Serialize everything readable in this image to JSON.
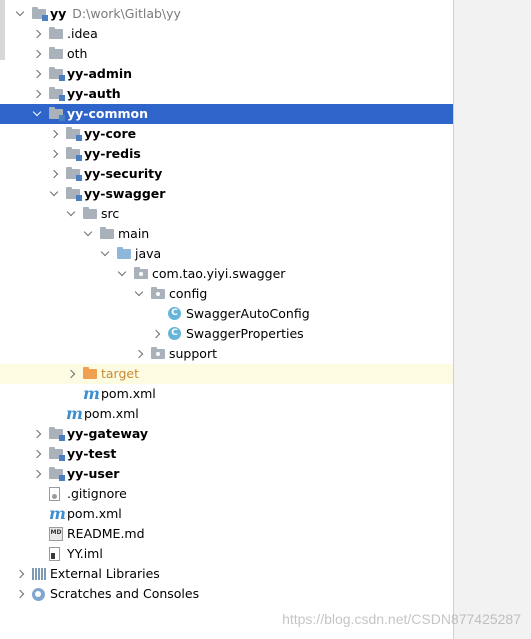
{
  "project": {
    "name": "yy",
    "path": "D:\\work\\Gitlab\\yy"
  },
  "tree": [
    {
      "name": "yy",
      "suffix": "D:\\work\\Gitlab\\yy",
      "bold": true,
      "depth": 0,
      "arrow": "down",
      "icon": "module-folder-icon",
      "kind": "module"
    },
    {
      "name": ".idea",
      "depth": 1,
      "arrow": "right",
      "icon": "folder-icon",
      "kind": "folder"
    },
    {
      "name": "oth",
      "depth": 1,
      "arrow": "right",
      "icon": "folder-icon",
      "kind": "folder"
    },
    {
      "name": "yy-admin",
      "bold": true,
      "depth": 1,
      "arrow": "right",
      "icon": "module-folder-icon",
      "kind": "module"
    },
    {
      "name": "yy-auth",
      "bold": true,
      "depth": 1,
      "arrow": "right",
      "icon": "module-folder-icon",
      "kind": "module"
    },
    {
      "name": "yy-common",
      "bold": true,
      "depth": 1,
      "arrow": "down",
      "icon": "module-folder-icon",
      "kind": "module",
      "selected": true
    },
    {
      "name": "yy-core",
      "bold": true,
      "depth": 2,
      "arrow": "right",
      "icon": "module-folder-icon",
      "kind": "module"
    },
    {
      "name": "yy-redis",
      "bold": true,
      "depth": 2,
      "arrow": "right",
      "icon": "module-folder-icon",
      "kind": "module"
    },
    {
      "name": "yy-security",
      "bold": true,
      "depth": 2,
      "arrow": "right",
      "icon": "module-folder-icon",
      "kind": "module"
    },
    {
      "name": "yy-swagger",
      "bold": true,
      "depth": 2,
      "arrow": "down",
      "icon": "module-folder-icon",
      "kind": "module"
    },
    {
      "name": "src",
      "depth": 3,
      "arrow": "down",
      "icon": "folder-icon",
      "kind": "folder"
    },
    {
      "name": "main",
      "depth": 4,
      "arrow": "down",
      "icon": "folder-icon",
      "kind": "folder"
    },
    {
      "name": "java",
      "depth": 5,
      "arrow": "down",
      "icon": "source-folder-icon",
      "kind": "source"
    },
    {
      "name": "com.tao.yiyi.swagger",
      "depth": 6,
      "arrow": "down",
      "icon": "package-icon",
      "kind": "package"
    },
    {
      "name": "config",
      "depth": 7,
      "arrow": "down",
      "icon": "package-icon",
      "kind": "package"
    },
    {
      "name": "SwaggerAutoConfig",
      "depth": 8,
      "arrow": "none",
      "icon": "class-icon",
      "kind": "class"
    },
    {
      "name": "SwaggerProperties",
      "depth": 8,
      "arrow": "right",
      "icon": "class-icon",
      "kind": "class"
    },
    {
      "name": "support",
      "depth": 7,
      "arrow": "right",
      "icon": "package-icon",
      "kind": "package"
    },
    {
      "name": "target",
      "depth": 3,
      "arrow": "right",
      "icon": "excluded-folder-icon",
      "kind": "excluded",
      "highlight": true
    },
    {
      "name": "pom.xml",
      "depth": 3,
      "arrow": "none",
      "icon": "maven-icon",
      "kind": "maven"
    },
    {
      "name": "pom.xml",
      "depth": 2,
      "arrow": "none",
      "icon": "maven-icon",
      "kind": "maven"
    },
    {
      "name": "yy-gateway",
      "bold": true,
      "depth": 1,
      "arrow": "right",
      "icon": "module-folder-icon",
      "kind": "module"
    },
    {
      "name": "yy-test",
      "bold": true,
      "depth": 1,
      "arrow": "right",
      "icon": "module-folder-icon",
      "kind": "module"
    },
    {
      "name": "yy-user",
      "bold": true,
      "depth": 1,
      "arrow": "right",
      "icon": "module-folder-icon",
      "kind": "module"
    },
    {
      "name": ".gitignore",
      "depth": 1,
      "arrow": "none",
      "icon": "gitignore-file-icon",
      "kind": "git"
    },
    {
      "name": "pom.xml",
      "depth": 1,
      "arrow": "none",
      "icon": "maven-icon",
      "kind": "maven"
    },
    {
      "name": "README.md",
      "depth": 1,
      "arrow": "none",
      "icon": "markdown-file-icon",
      "kind": "md"
    },
    {
      "name": "YY.iml",
      "depth": 1,
      "arrow": "none",
      "icon": "iml-file-icon",
      "kind": "iml"
    },
    {
      "name": "External Libraries",
      "depth": 0,
      "arrow": "right",
      "icon": "library-icon",
      "kind": "lib"
    },
    {
      "name": "Scratches and Consoles",
      "depth": 0,
      "arrow": "right",
      "icon": "scratches-icon",
      "kind": "scratch"
    }
  ],
  "watermark": "https://blog.csdn.net/CSDN877425287"
}
